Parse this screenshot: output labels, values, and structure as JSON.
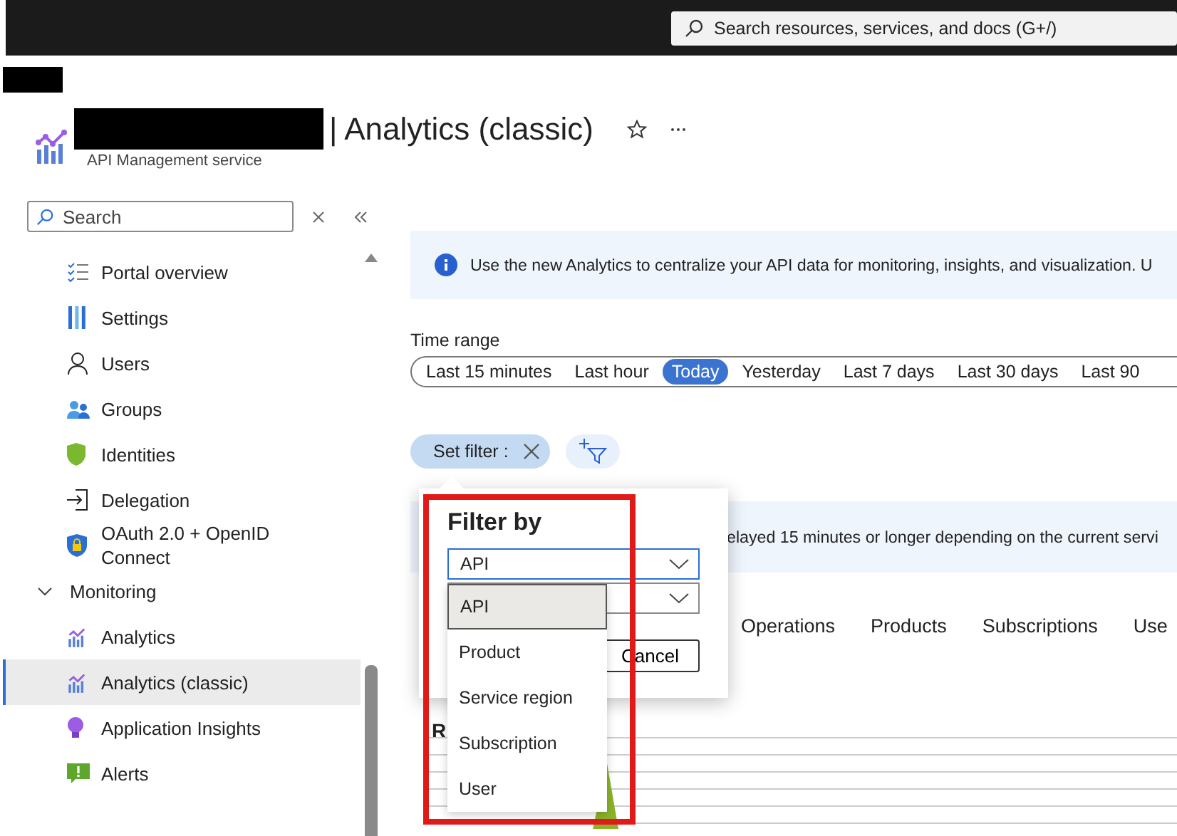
{
  "top_bar": {
    "search": {
      "placeholder": "Search resources, services, and docs (G+/)"
    }
  },
  "header": {
    "title": "| Analytics (classic)",
    "subtitle": "API Management service"
  },
  "sidebar": {
    "search": {
      "placeholder": "Search"
    },
    "items": [
      {
        "label": "Portal overview",
        "selected": false
      },
      {
        "label": "Settings",
        "selected": false
      },
      {
        "label": "Users",
        "selected": false
      },
      {
        "label": "Groups",
        "selected": false
      },
      {
        "label": "Identities",
        "selected": false
      },
      {
        "label": "Delegation",
        "selected": false
      },
      {
        "label": "OAuth 2.0 + OpenID Connect",
        "selected": false
      }
    ],
    "groups": [
      {
        "label": "Monitoring",
        "expanded": true,
        "children": [
          {
            "label": "Analytics",
            "selected": false
          },
          {
            "label": "Analytics (classic)",
            "selected": true
          },
          {
            "label": "Application Insights",
            "selected": false
          },
          {
            "label": "Alerts",
            "selected": false
          }
        ]
      }
    ]
  },
  "info_banner": {
    "text": "Use the new Analytics to centralize your API data for monitoring, insights, and visualization. U"
  },
  "time_range": {
    "label": "Time range",
    "options": [
      {
        "label": "Last 15 minutes",
        "selected": false
      },
      {
        "label": "Last hour",
        "selected": false
      },
      {
        "label": "Today",
        "selected": true
      },
      {
        "label": "Yesterday",
        "selected": false
      },
      {
        "label": "Last 7 days",
        "selected": false
      },
      {
        "label": "Last 30 days",
        "selected": false
      },
      {
        "label": "Last 90",
        "selected": false
      }
    ]
  },
  "filter_chip": {
    "label": "Set filter :"
  },
  "delay_banner": {
    "text": "elayed 15 minutes or longer depending on the current servi"
  },
  "tabs": [
    "Operations",
    "Products",
    "Subscriptions",
    "Use"
  ],
  "chart": {
    "title": "R"
  },
  "filter_popup": {
    "title": "Filter by",
    "fields": [
      {
        "value": "API",
        "focused": true
      },
      {
        "focused": false
      }
    ],
    "cancel_button": "Cancel",
    "dropdown_options": [
      {
        "label": "API",
        "selected": true
      },
      {
        "label": "Product",
        "selected": false
      },
      {
        "label": "Service region",
        "selected": false
      },
      {
        "label": "Subscription",
        "selected": false
      },
      {
        "label": "User",
        "selected": false
      }
    ]
  }
}
